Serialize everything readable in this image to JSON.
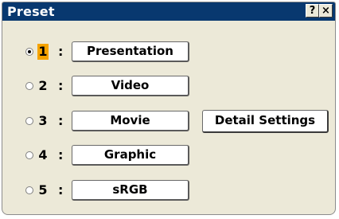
{
  "window": {
    "title": "Preset",
    "help_label": "?",
    "close_label": "×"
  },
  "presets": [
    {
      "number": "1",
      "separator": ":",
      "label": "Presentation",
      "selected": true
    },
    {
      "number": "2",
      "separator": ":",
      "label": "Video",
      "selected": false
    },
    {
      "number": "3",
      "separator": ":",
      "label": "Movie",
      "selected": false
    },
    {
      "number": "4",
      "separator": ":",
      "label": "Graphic",
      "selected": false
    },
    {
      "number": "5",
      "separator": ":",
      "label": "sRGB",
      "selected": false
    }
  ],
  "detail_button": "Detail Settings",
  "colors": {
    "titlebar": "#08386f",
    "background": "#ece9d8",
    "selection": "#f5a300"
  }
}
